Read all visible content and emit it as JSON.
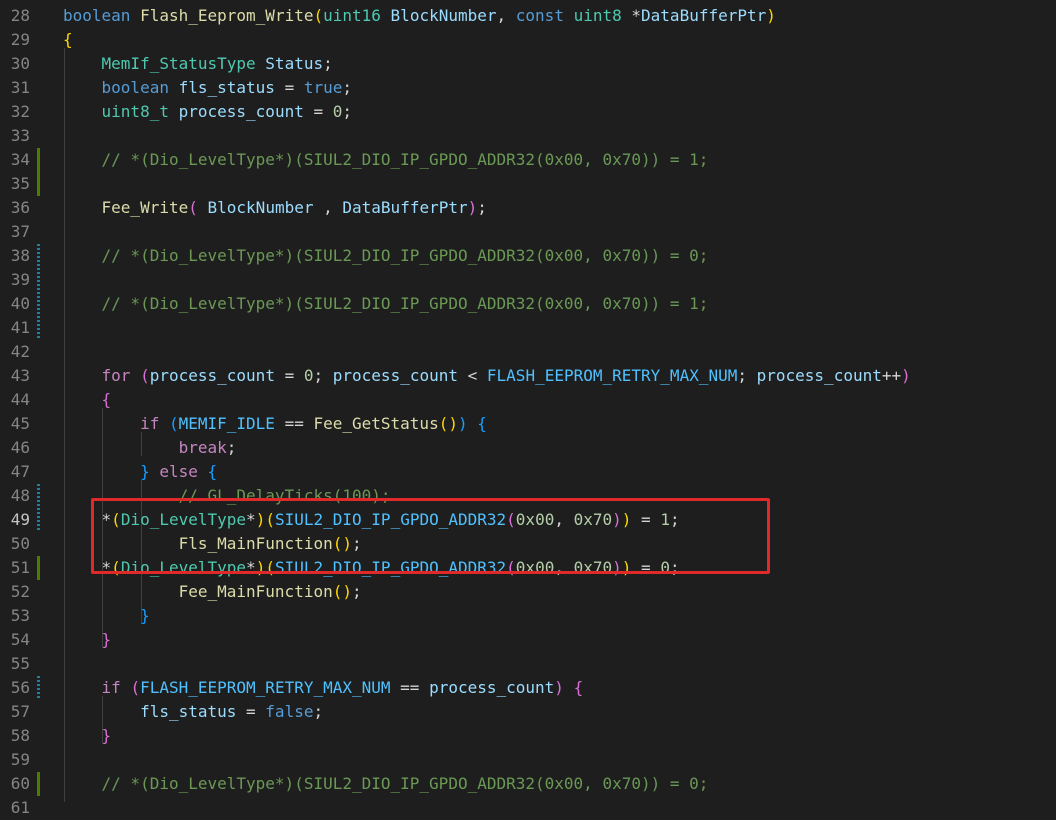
{
  "editor": {
    "name": "code-editor",
    "colors": {
      "background": "#1e1e1e",
      "keyword": "#569cd6",
      "control": "#c586c0",
      "type": "#4ec9b0",
      "function": "#dcdcaa",
      "variable": "#9cdcfe",
      "macro": "#4fc1ff",
      "number": "#b5cea8",
      "comment": "#6a9955",
      "highlight_border": "#e02a2a",
      "git_added": "#487e02",
      "git_modified": "#1b81a8"
    },
    "lines": [
      {
        "n": "28",
        "tokens": [
          [
            "kw",
            "boolean"
          ],
          [
            "pn",
            " "
          ],
          [
            "fn",
            "Flash_Eeprom_Write"
          ],
          [
            "b1",
            "("
          ],
          [
            "ty",
            "uint16"
          ],
          [
            "pn",
            " "
          ],
          [
            "var",
            "BlockNumber"
          ],
          [
            "pn",
            ", "
          ],
          [
            "kw",
            "const"
          ],
          [
            "pn",
            " "
          ],
          [
            "ty",
            "uint8"
          ],
          [
            "pn",
            " *"
          ],
          [
            "var",
            "DataBufferPtr"
          ],
          [
            "b1",
            ")"
          ]
        ]
      },
      {
        "n": "29",
        "tokens": [
          [
            "b1",
            "{"
          ]
        ]
      },
      {
        "n": "30",
        "tokens": [
          [
            "pn",
            "    "
          ],
          [
            "ty",
            "MemIf_StatusType"
          ],
          [
            "pn",
            " "
          ],
          [
            "var",
            "Status"
          ],
          [
            "pn",
            ";"
          ]
        ]
      },
      {
        "n": "31",
        "tokens": [
          [
            "pn",
            "    "
          ],
          [
            "kw",
            "boolean"
          ],
          [
            "pn",
            " "
          ],
          [
            "var",
            "fls_status"
          ],
          [
            "pn",
            " = "
          ],
          [
            "kw",
            "true"
          ],
          [
            "pn",
            ";"
          ]
        ]
      },
      {
        "n": "32",
        "tokens": [
          [
            "pn",
            "    "
          ],
          [
            "ty",
            "uint8_t"
          ],
          [
            "pn",
            " "
          ],
          [
            "var",
            "process_count"
          ],
          [
            "pn",
            " = "
          ],
          [
            "num",
            "0"
          ],
          [
            "pn",
            ";"
          ]
        ]
      },
      {
        "n": "33",
        "tokens": []
      },
      {
        "n": "34",
        "git": "added",
        "tokens": [
          [
            "pn",
            "    "
          ],
          [
            "cm",
            "// *(Dio_LevelType*)(SIUL2_DIO_IP_GPDO_ADDR32(0x00, 0x70)) = 1;"
          ]
        ]
      },
      {
        "n": "35",
        "git": "added",
        "tokens": []
      },
      {
        "n": "36",
        "tokens": [
          [
            "pn",
            "    "
          ],
          [
            "fn",
            "Fee_Write"
          ],
          [
            "b2",
            "("
          ],
          [
            "pn",
            " "
          ],
          [
            "var",
            "BlockNumber"
          ],
          [
            "pn",
            " , "
          ],
          [
            "var",
            "DataBufferPtr"
          ],
          [
            "b2",
            ")"
          ],
          [
            "pn",
            ";"
          ]
        ]
      },
      {
        "n": "37",
        "tokens": []
      },
      {
        "n": "38",
        "git": "modified",
        "tokens": [
          [
            "pn",
            "    "
          ],
          [
            "cm",
            "// *(Dio_LevelType*)(SIUL2_DIO_IP_GPDO_ADDR32(0x00, 0x70)) = 0;"
          ]
        ]
      },
      {
        "n": "39",
        "git": "modified",
        "tokens": []
      },
      {
        "n": "40",
        "git": "modified",
        "tokens": [
          [
            "pn",
            "    "
          ],
          [
            "cm",
            "// *(Dio_LevelType*)(SIUL2_DIO_IP_GPDO_ADDR32(0x00, 0x70)) = 1;"
          ]
        ]
      },
      {
        "n": "41",
        "git": "modified",
        "tokens": []
      },
      {
        "n": "42",
        "tokens": []
      },
      {
        "n": "43",
        "tokens": [
          [
            "pn",
            "    "
          ],
          [
            "ctl",
            "for"
          ],
          [
            "pn",
            " "
          ],
          [
            "b2",
            "("
          ],
          [
            "var",
            "process_count"
          ],
          [
            "pn",
            " = "
          ],
          [
            "num",
            "0"
          ],
          [
            "pn",
            "; "
          ],
          [
            "var",
            "process_count"
          ],
          [
            "pn",
            " < "
          ],
          [
            "mac",
            "FLASH_EEPROM_RETRY_MAX_NUM"
          ],
          [
            "pn",
            "; "
          ],
          [
            "var",
            "process_count"
          ],
          [
            "pn",
            "++"
          ],
          [
            "b2",
            ")"
          ]
        ]
      },
      {
        "n": "44",
        "tokens": [
          [
            "pn",
            "    "
          ],
          [
            "b2",
            "{"
          ]
        ]
      },
      {
        "n": "45",
        "tokens": [
          [
            "pn",
            "        "
          ],
          [
            "ctl",
            "if"
          ],
          [
            "pn",
            " "
          ],
          [
            "b3",
            "("
          ],
          [
            "mac",
            "MEMIF_IDLE"
          ],
          [
            "pn",
            " == "
          ],
          [
            "fn",
            "Fee_GetStatus"
          ],
          [
            "b1",
            "()"
          ],
          [
            "b3",
            ")"
          ],
          [
            "pn",
            " "
          ],
          [
            "b3",
            "{"
          ]
        ]
      },
      {
        "n": "46",
        "tokens": [
          [
            "pn",
            "            "
          ],
          [
            "ctl",
            "break"
          ],
          [
            "pn",
            ";"
          ]
        ]
      },
      {
        "n": "47",
        "tokens": [
          [
            "pn",
            "        "
          ],
          [
            "b3",
            "}"
          ],
          [
            "pn",
            " "
          ],
          [
            "ctl",
            "else"
          ],
          [
            "pn",
            " "
          ],
          [
            "b3",
            "{"
          ]
        ]
      },
      {
        "n": "48",
        "git": "modified",
        "tokens": [
          [
            "pn",
            "            "
          ],
          [
            "cm",
            "// GL_DelayTicks(100);"
          ]
        ]
      },
      {
        "n": "49",
        "git": "modified",
        "active": true,
        "tokens": [
          [
            "pn",
            "    *"
          ],
          [
            "b1",
            "("
          ],
          [
            "ty",
            "Dio_LevelType"
          ],
          [
            "pn",
            "*"
          ],
          [
            "b1",
            ")"
          ],
          [
            "b1",
            "("
          ],
          [
            "mac",
            "SIUL2_DIO_IP_GPDO_ADDR32"
          ],
          [
            "b2",
            "("
          ],
          [
            "num",
            "0x00"
          ],
          [
            "pn",
            ", "
          ],
          [
            "num",
            "0x70"
          ],
          [
            "b2",
            ")"
          ],
          [
            "b1",
            ")"
          ],
          [
            "pn",
            " = "
          ],
          [
            "num",
            "1"
          ],
          [
            "pn",
            ";"
          ]
        ]
      },
      {
        "n": "50",
        "tokens": [
          [
            "pn",
            "            "
          ],
          [
            "fn",
            "Fls_MainFunction"
          ],
          [
            "b1",
            "()"
          ],
          [
            "pn",
            ";"
          ]
        ]
      },
      {
        "n": "51",
        "git": "added",
        "tokens": [
          [
            "pn",
            "    *"
          ],
          [
            "b1",
            "("
          ],
          [
            "ty",
            "Dio_LevelType"
          ],
          [
            "pn",
            "*"
          ],
          [
            "b1",
            ")"
          ],
          [
            "b1",
            "("
          ],
          [
            "mac",
            "SIUL2_DIO_IP_GPDO_ADDR32"
          ],
          [
            "b2",
            "("
          ],
          [
            "num",
            "0x00"
          ],
          [
            "pn",
            ", "
          ],
          [
            "num",
            "0x70"
          ],
          [
            "b2",
            ")"
          ],
          [
            "b1",
            ")"
          ],
          [
            "pn",
            " = "
          ],
          [
            "num",
            "0"
          ],
          [
            "pn",
            ";"
          ]
        ]
      },
      {
        "n": "52",
        "tokens": [
          [
            "pn",
            "            "
          ],
          [
            "fn",
            "Fee_MainFunction"
          ],
          [
            "b1",
            "()"
          ],
          [
            "pn",
            ";"
          ]
        ]
      },
      {
        "n": "53",
        "tokens": [
          [
            "pn",
            "        "
          ],
          [
            "b3",
            "}"
          ]
        ]
      },
      {
        "n": "54",
        "tokens": [
          [
            "pn",
            "    "
          ],
          [
            "b2",
            "}"
          ]
        ]
      },
      {
        "n": "55",
        "tokens": []
      },
      {
        "n": "56",
        "git": "modified",
        "tokens": [
          [
            "pn",
            "    "
          ],
          [
            "ctl",
            "if"
          ],
          [
            "pn",
            " "
          ],
          [
            "b2",
            "("
          ],
          [
            "mac",
            "FLASH_EEPROM_RETRY_MAX_NUM"
          ],
          [
            "pn",
            " == "
          ],
          [
            "var",
            "process_count"
          ],
          [
            "b2",
            ")"
          ],
          [
            "pn",
            " "
          ],
          [
            "b2",
            "{"
          ]
        ]
      },
      {
        "n": "57",
        "tokens": [
          [
            "pn",
            "        "
          ],
          [
            "var",
            "fls_status"
          ],
          [
            "pn",
            " = "
          ],
          [
            "kw",
            "false"
          ],
          [
            "pn",
            ";"
          ]
        ]
      },
      {
        "n": "58",
        "tokens": [
          [
            "pn",
            "    "
          ],
          [
            "b2",
            "}"
          ]
        ]
      },
      {
        "n": "59",
        "tokens": []
      },
      {
        "n": "60",
        "git": "added",
        "tokens": [
          [
            "pn",
            "    "
          ],
          [
            "cm",
            "// *(Dio_LevelType*)(SIUL2_DIO_IP_GPDO_ADDR32(0x00, 0x70)) = 0;"
          ]
        ]
      },
      {
        "n": "61",
        "tokens": []
      }
    ]
  }
}
